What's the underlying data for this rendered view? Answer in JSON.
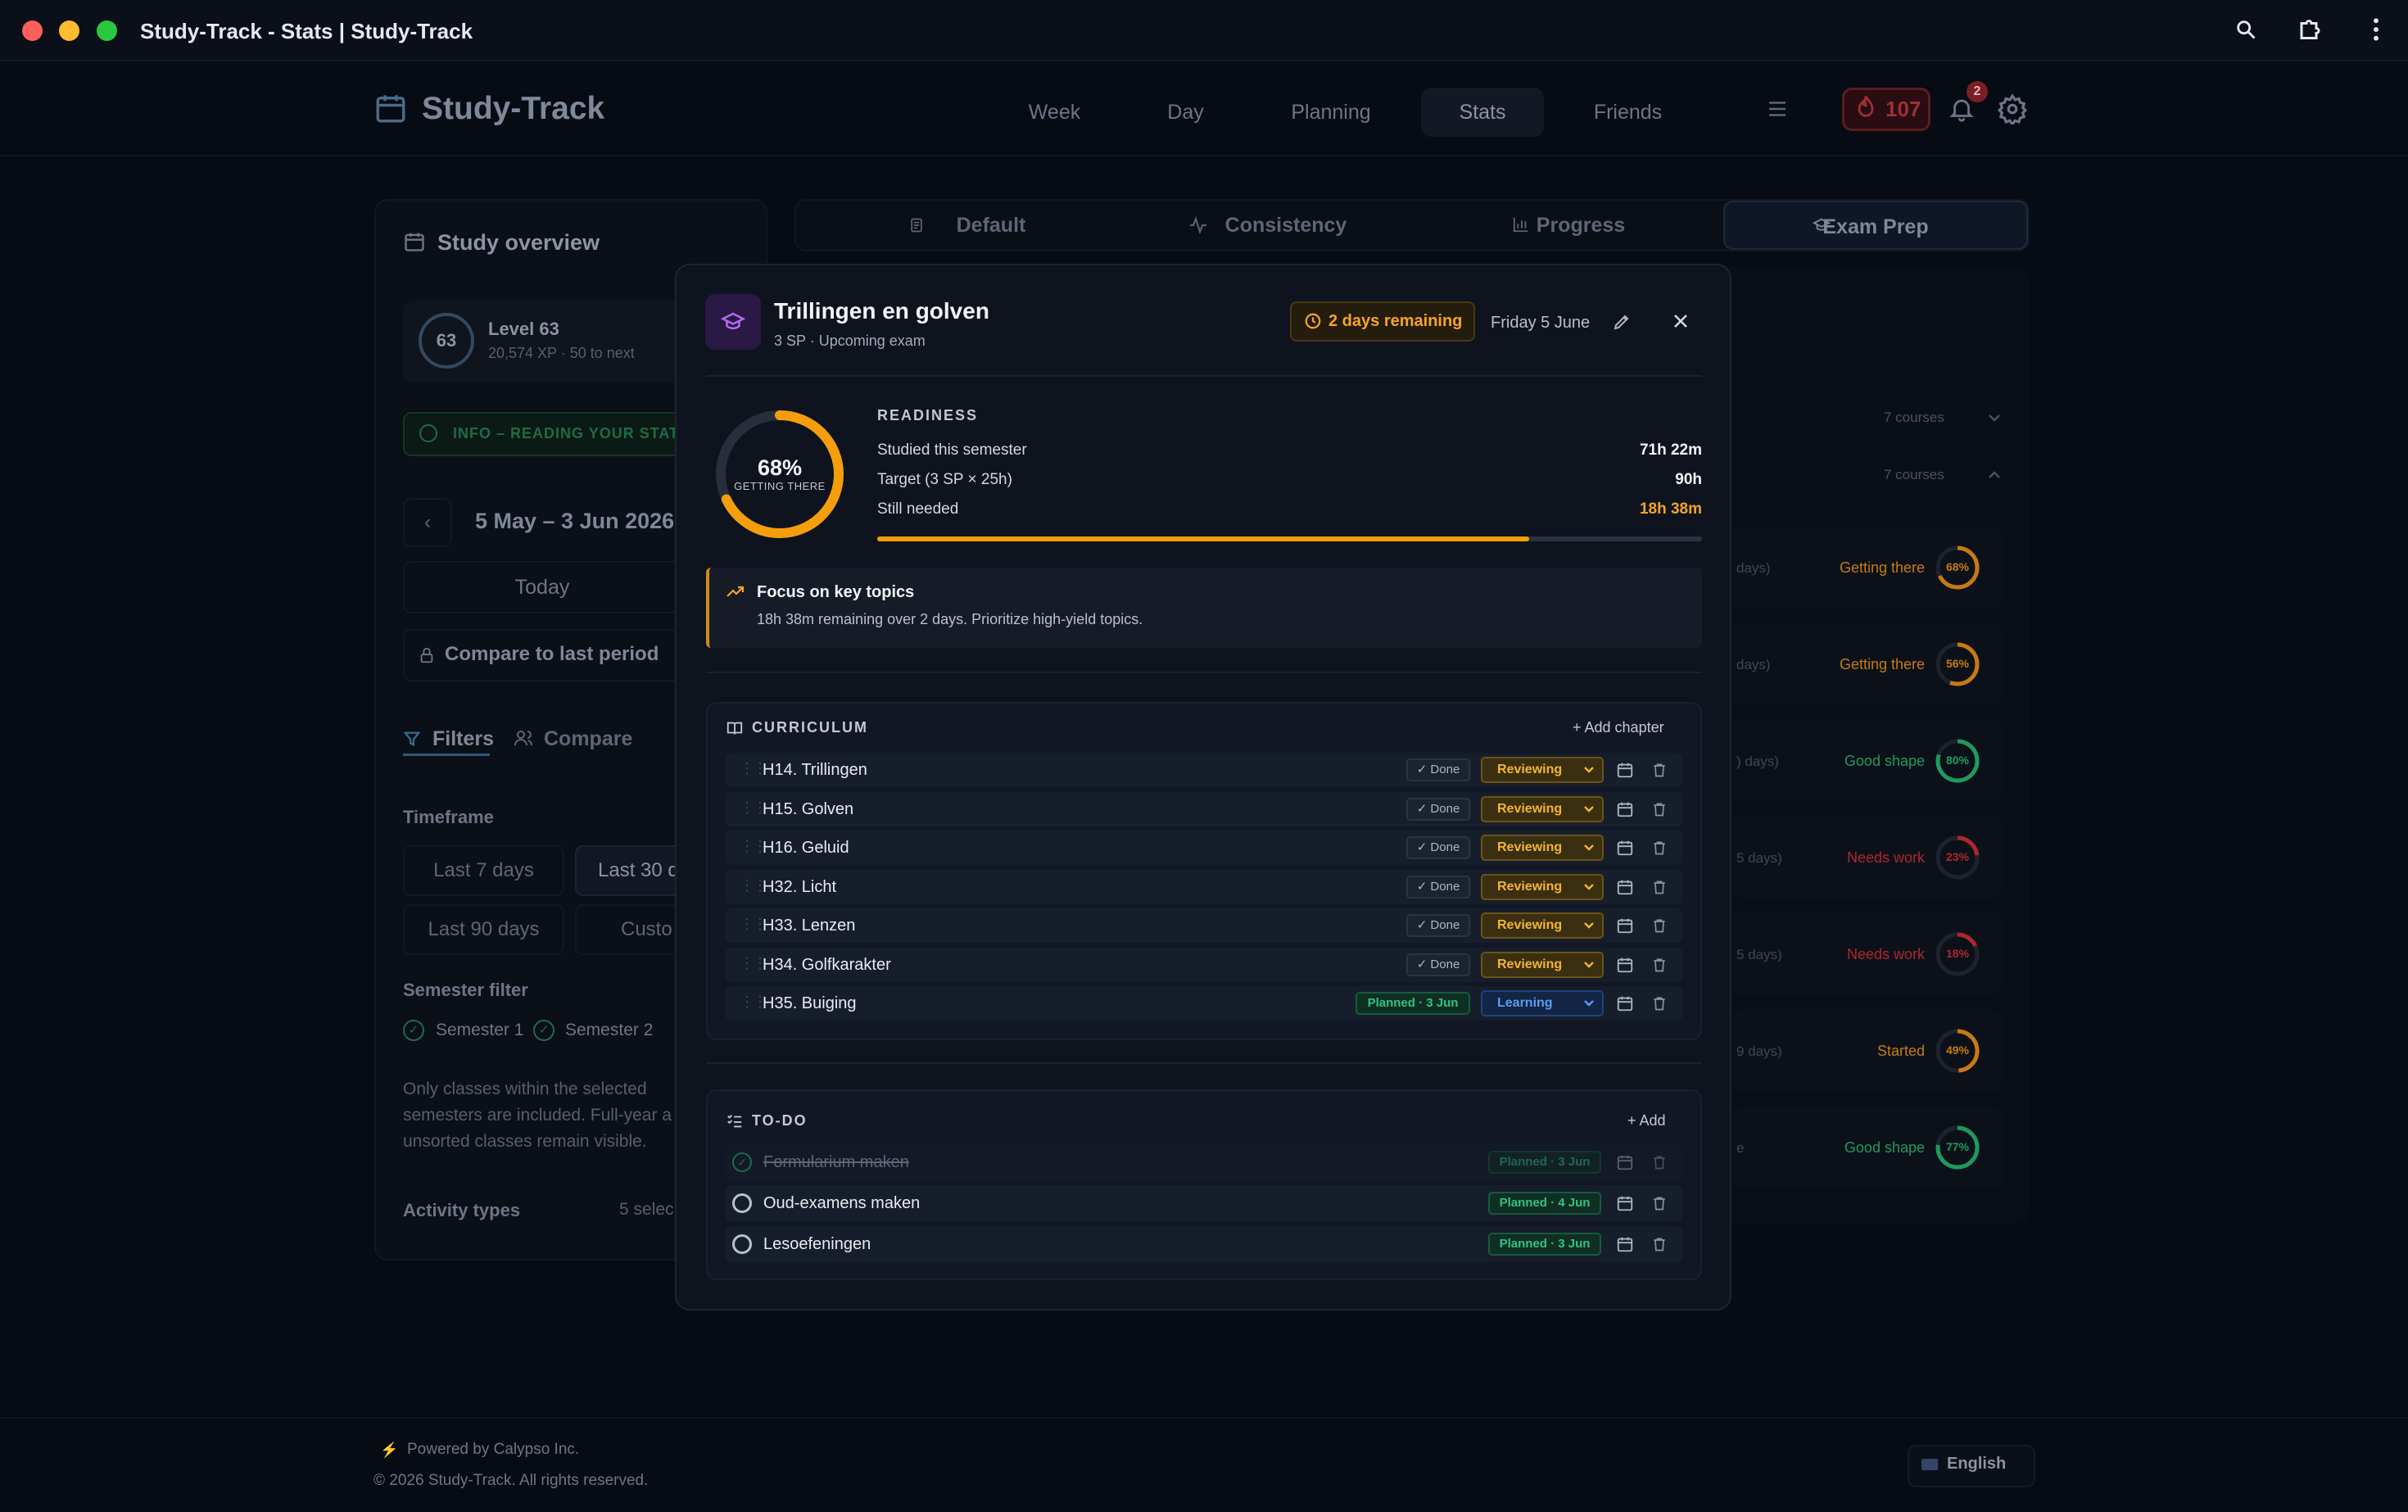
{
  "window": {
    "title": "Study-Track - Stats | Study-Track"
  },
  "nav": {
    "brand": "Study-Track",
    "tabs": [
      "Week",
      "Day",
      "Planning",
      "Stats",
      "Friends"
    ],
    "active_tab": "Stats",
    "streak": "107",
    "notifications": "2"
  },
  "overview": {
    "title": "Study overview",
    "level_badge": "63",
    "level": "Level 63",
    "xp": "20,574 XP · 50 to next",
    "info": "INFO – READING YOUR STAT",
    "range": "5 May – 3 Jun 2026",
    "today": "Today",
    "compare_last": "Compare to last period",
    "filters_tab": "Filters",
    "compare_tab": "Compare",
    "timeframe_label": "Timeframe",
    "timeframes": [
      "Last 7 days",
      "Last 30 d",
      "Last 90 days",
      "Custo"
    ],
    "semester_label": "Semester filter",
    "semesters": [
      "Semester 1",
      "Semester 2"
    ],
    "semester_note": [
      "Only classes within the selected",
      "semesters are included. Full-year a",
      "unsorted classes remain visible."
    ],
    "activity_label": "Activity types",
    "activity_value": "5 selec"
  },
  "subtabs": [
    "Default",
    "Consistency",
    "Progress",
    "Exam Prep"
  ],
  "background_rows": {
    "courses_a": "7 courses",
    "courses_b": "7 courses",
    "rows": [
      {
        "days": "days)",
        "status": "Getting there",
        "pct": "68%",
        "fraction": 0.68,
        "color": "#c77a12"
      },
      {
        "days": "days)",
        "status": "Getting there",
        "pct": "56%",
        "fraction": 0.56,
        "color": "#c77a12"
      },
      {
        "days": ") days)",
        "status": "Good shape",
        "pct": "80%",
        "fraction": 0.8,
        "color": "#1f9a5f"
      },
      {
        "days": "5 days)",
        "status": "Needs work",
        "pct": "23%",
        "fraction": 0.23,
        "color": "#b0262d"
      },
      {
        "days": "5 days)",
        "status": "Needs work",
        "pct": "18%",
        "fraction": 0.18,
        "color": "#b0262d"
      },
      {
        "days": "9 days)",
        "status": "Started",
        "pct": "49%",
        "fraction": 0.49,
        "color": "#c77a12"
      },
      {
        "days": "e",
        "status": "Good shape",
        "pct": "77%",
        "fraction": 0.77,
        "color": "#1f9a5f"
      }
    ]
  },
  "modal": {
    "title": "Trillingen en golven",
    "subtitle": "3 SP · Upcoming exam",
    "remaining": "2 days remaining",
    "date": "Friday 5 June",
    "readiness": {
      "heading": "READINESS",
      "pct": "68%",
      "fraction": 0.68,
      "label": "GETTING THERE",
      "rows": [
        {
          "label": "Studied this semester",
          "value": "71h 22m"
        },
        {
          "label": "Target (3 SP × 25h)",
          "value": "90h"
        },
        {
          "label": "Still needed",
          "value": "18h 38m"
        }
      ],
      "progress": 0.79
    },
    "focus": {
      "title": "Focus on key topics",
      "text": "18h 38m remaining over 2 days. Prioritize high-yield topics."
    },
    "curriculum": {
      "heading": "CURRICULUM",
      "add": "+ Add chapter",
      "done_label": "✓ Done",
      "chapters": [
        {
          "name": "H14. Trillingen",
          "tag": "✓ Done",
          "status": "Reviewing"
        },
        {
          "name": "H15. Golven",
          "tag": "✓ Done",
          "status": "Reviewing"
        },
        {
          "name": "H16. Geluid",
          "tag": "✓ Done",
          "status": "Reviewing"
        },
        {
          "name": "H32. Licht",
          "tag": "✓ Done",
          "status": "Reviewing"
        },
        {
          "name": "H33. Lenzen",
          "tag": "✓ Done",
          "status": "Reviewing"
        },
        {
          "name": "H34. Golfkarakter",
          "tag": "✓ Done",
          "status": "Reviewing"
        },
        {
          "name": "H35. Buiging",
          "tag": "Planned · 3 Jun",
          "status": "Learning"
        }
      ]
    },
    "todo": {
      "heading": "TO-DO",
      "add": "+ Add",
      "items": [
        {
          "name": "Formularium maken",
          "tag": "Planned · 3 Jun",
          "done": true
        },
        {
          "name": "Oud-examens maken",
          "tag": "Planned · 4 Jun",
          "done": false
        },
        {
          "name": "Lesoefeningen",
          "tag": "Planned · 3 Jun",
          "done": false
        }
      ]
    }
  },
  "footer": {
    "powered": "Powered by Calypso Inc.",
    "copyright": "© 2026 Study-Track. All rights reserved.",
    "language": "English"
  }
}
